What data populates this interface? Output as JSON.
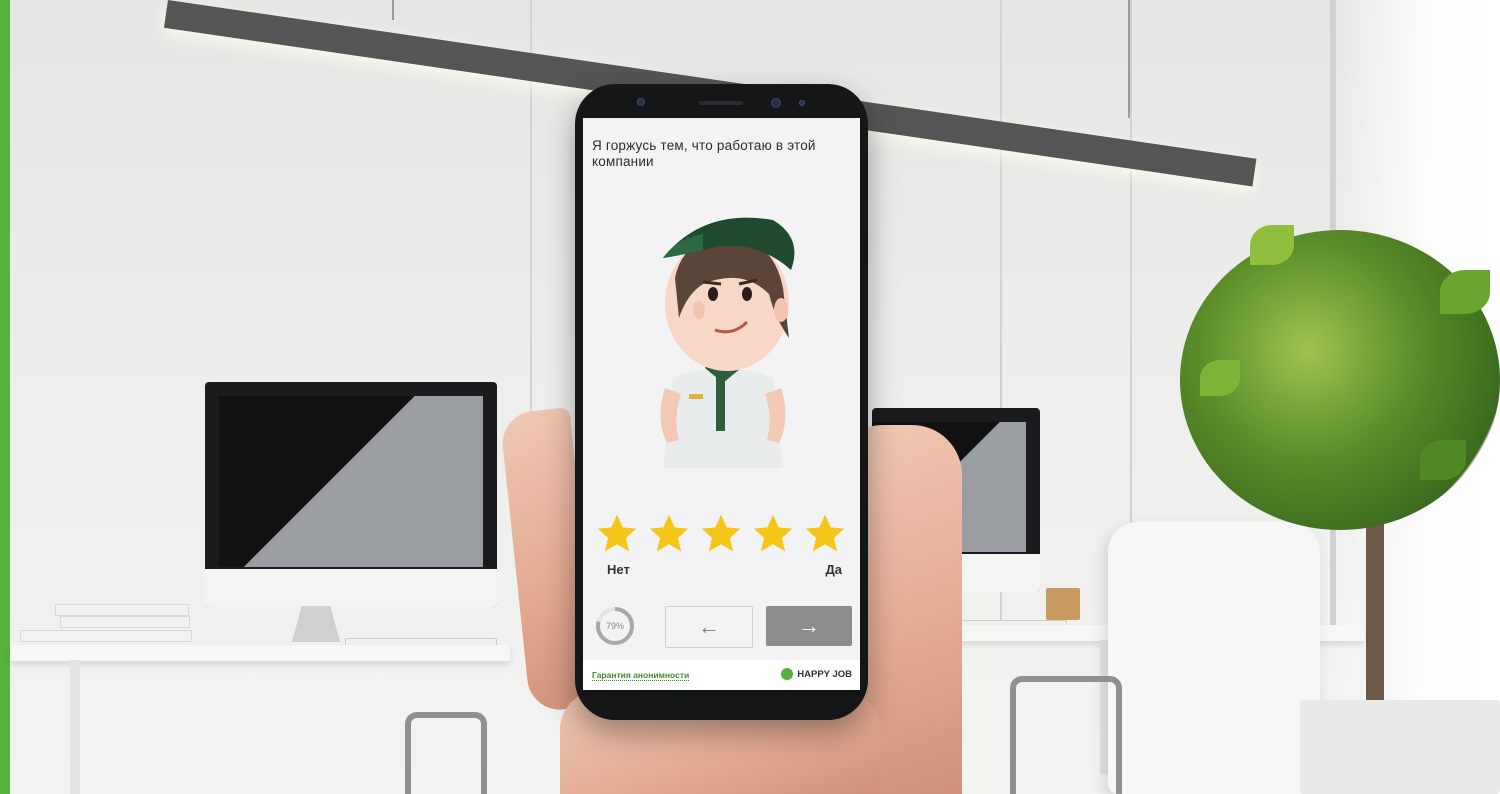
{
  "survey": {
    "question": "Я горжусь тем, что работаю в этой компании",
    "rating": {
      "max": 5,
      "selected": 5,
      "star_color": "#f5c518"
    },
    "scale_low_label": "Нет",
    "scale_high_label": "Да",
    "progress": {
      "value_text": "79%",
      "percent": 79
    },
    "nav": {
      "prev_icon": "arrow-left-icon",
      "prev_glyph": "←",
      "next_icon": "arrow-right-icon",
      "next_glyph": "→"
    }
  },
  "footer": {
    "anonymity_link": "Гарантия анонимности",
    "brand_name": "HAPPY JOB",
    "brand_color": "#56b23b"
  }
}
